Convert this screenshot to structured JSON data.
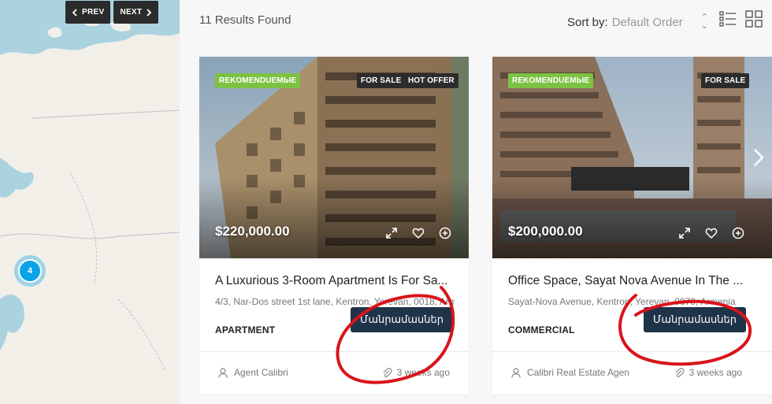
{
  "map": {
    "prev_label": "PREV",
    "next_label": "NEXT",
    "cluster_count": "4",
    "water_color": "#aad3df",
    "land_color": "#f2efe9"
  },
  "toolbar": {
    "results": "11 Results Found",
    "sort_label": "Sort by:",
    "sort_value": "Default Order"
  },
  "listings": [
    {
      "badge_featured": "REKOMENDUEMЫE",
      "badges": [
        "FOR SALE",
        "HOT OFFER"
      ],
      "price": "$220,000.00",
      "title": "A Luxurious 3-Room Apartment Is For Sa...",
      "address": "4/3, Nar-Dos street 1st lane, Kentron, Yerevan, 0018, Armenia",
      "category": "APARTMENT",
      "details_label": "Մանրամասներ",
      "agent": "Agent Calibri",
      "date": "3 weeks ago"
    },
    {
      "badge_featured": "REKOMENDUEMЫE",
      "badges": [
        "FOR SALE"
      ],
      "price": "$200,000.00",
      "title": "Office Space, Sayat Nova Avenue In The ...",
      "address": "Sayat-Nova Avenue, Kentron, Yerevan, 0070, Armenia",
      "category": "COMMERCIAL",
      "details_label": "Մանրամասներ",
      "agent": "Calibri Real Estate Agen",
      "date": "3 weeks ago"
    }
  ],
  "colors": {
    "accent_green": "#7cc243",
    "button_navy": "#1f3349",
    "annotation_red": "#d9141a"
  }
}
